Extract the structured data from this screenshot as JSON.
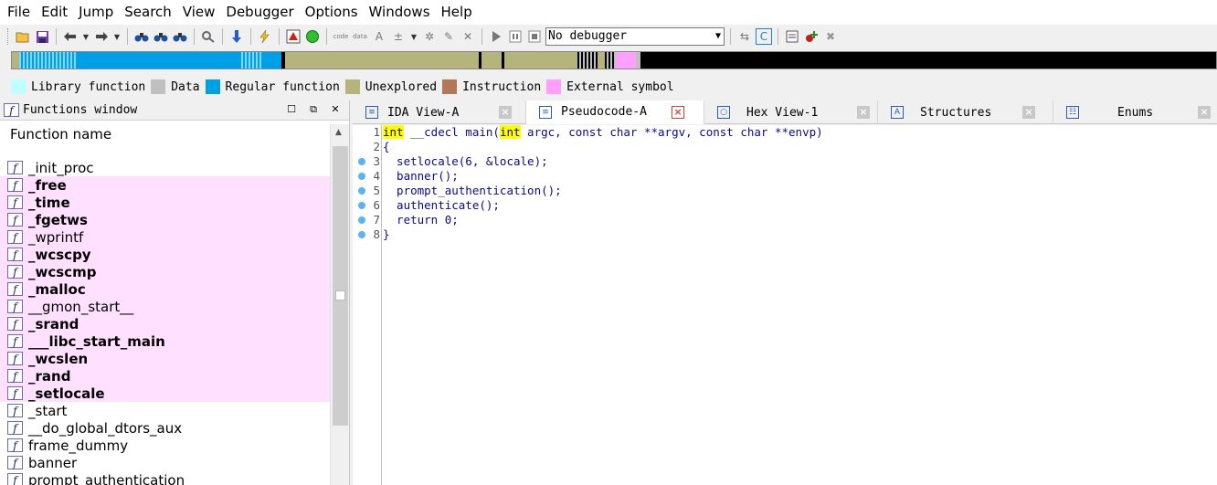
{
  "menu": [
    "File",
    "Edit",
    "Jump",
    "Search",
    "View",
    "Debugger",
    "Options",
    "Windows",
    "Help"
  ],
  "toolbar": {
    "debugger_select": "No debugger",
    "icons": [
      "open-icon",
      "save-icon",
      "back-icon",
      "forward-icon",
      "run-icon",
      "pause-icon",
      "stop-icon"
    ]
  },
  "legend": [
    {
      "label": "Library function",
      "color": "#c0ffff"
    },
    {
      "label": "Data",
      "color": "#c0c0c0"
    },
    {
      "label": "Regular function",
      "color": "#00a0e8"
    },
    {
      "label": "Unexplored",
      "color": "#b4b47c"
    },
    {
      "label": "Instruction",
      "color": "#b07858"
    },
    {
      "label": "External symbol",
      "color": "#ffa0ff"
    }
  ],
  "functions_window": {
    "title": "Functions window",
    "column_header": "Function name",
    "items": [
      {
        "name": "_init_proc",
        "bold": false,
        "pink": false
      },
      {
        "name": "_free",
        "bold": true,
        "pink": true
      },
      {
        "name": "_time",
        "bold": true,
        "pink": true
      },
      {
        "name": "_fgetws",
        "bold": true,
        "pink": true
      },
      {
        "name": "_wprintf",
        "bold": false,
        "pink": true
      },
      {
        "name": "_wcscpy",
        "bold": true,
        "pink": true
      },
      {
        "name": "_wcscmp",
        "bold": true,
        "pink": true
      },
      {
        "name": "_malloc",
        "bold": true,
        "pink": true
      },
      {
        "name": "__gmon_start__",
        "bold": false,
        "pink": true
      },
      {
        "name": "_srand",
        "bold": true,
        "pink": true
      },
      {
        "name": "___libc_start_main",
        "bold": true,
        "pink": true
      },
      {
        "name": "_wcslen",
        "bold": true,
        "pink": true
      },
      {
        "name": "_rand",
        "bold": true,
        "pink": true
      },
      {
        "name": "_setlocale",
        "bold": true,
        "pink": true
      },
      {
        "name": "_start",
        "bold": false,
        "pink": false
      },
      {
        "name": "__do_global_dtors_aux",
        "bold": false,
        "pink": false
      },
      {
        "name": "frame_dummy",
        "bold": false,
        "pink": false
      },
      {
        "name": "banner",
        "bold": false,
        "pink": false
      },
      {
        "name": "prompt_authentication",
        "bold": false,
        "pink": false
      }
    ]
  },
  "tabs": [
    {
      "label": "IDA View-A",
      "active": false
    },
    {
      "label": "Pseudocode-A",
      "active": true
    },
    {
      "label": "Hex View-1",
      "active": false
    },
    {
      "label": "Structures",
      "active": false
    },
    {
      "label": "Enums",
      "active": false
    }
  ],
  "code": {
    "lines": [
      {
        "num": "1",
        "pre": "",
        "kw": "int",
        "text": " __cdecl main(",
        "kw2": "int",
        "post": " argc, const char **argv, const char **envp)",
        "bp": false
      },
      {
        "num": "2",
        "text": "{",
        "bp": false
      },
      {
        "num": "3",
        "text": "  setlocale(6, &locale);",
        "bp": true
      },
      {
        "num": "4",
        "text": "  banner();",
        "bp": true
      },
      {
        "num": "5",
        "text": "  prompt_authentication();",
        "bp": true
      },
      {
        "num": "6",
        "text": "  authenticate();",
        "bp": true
      },
      {
        "num": "7",
        "text": "  return 0;",
        "bp": true
      },
      {
        "num": "8",
        "text": "}",
        "bp": true
      }
    ]
  },
  "colors": {
    "external_pink": "#ffe1ff",
    "code_text": "#0a0a80",
    "highlight": "#ffff00",
    "breakpoint_dot": "#5bb4f0"
  }
}
